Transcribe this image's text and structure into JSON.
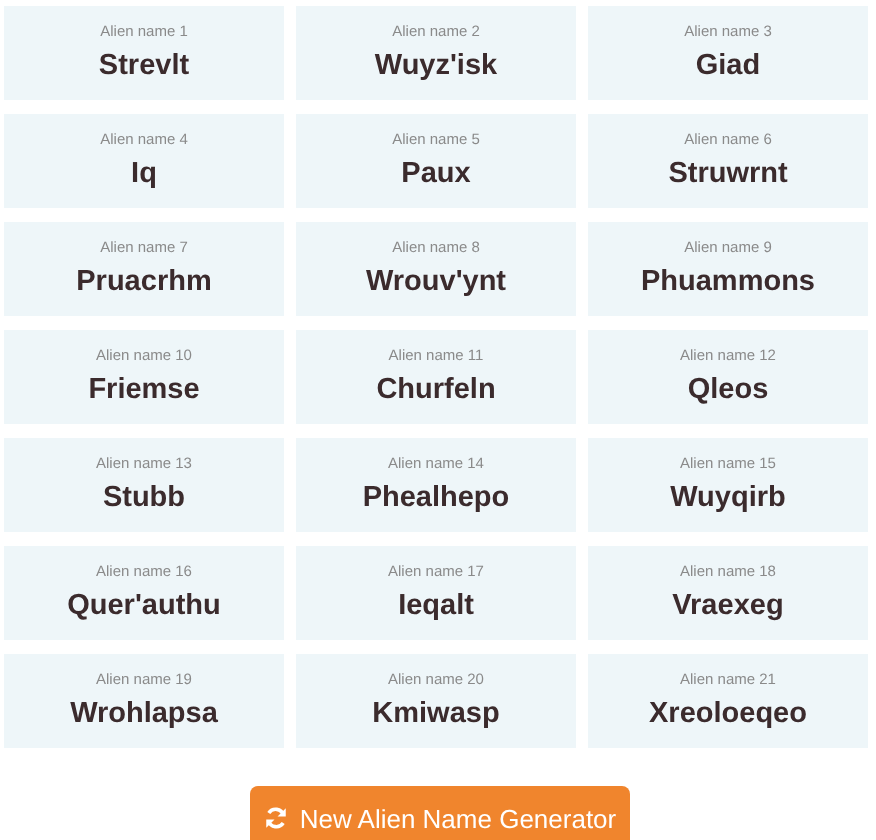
{
  "names": [
    {
      "label": "Alien name 1",
      "name": "Strevlt"
    },
    {
      "label": "Alien name 2",
      "name": "Wuyz'isk"
    },
    {
      "label": "Alien name 3",
      "name": "Giad"
    },
    {
      "label": "Alien name 4",
      "name": "Iq"
    },
    {
      "label": "Alien name 5",
      "name": "Paux"
    },
    {
      "label": "Alien name 6",
      "name": "Struwrnt"
    },
    {
      "label": "Alien name 7",
      "name": "Pruacrhm"
    },
    {
      "label": "Alien name 8",
      "name": "Wrouv'ynt"
    },
    {
      "label": "Alien name 9",
      "name": "Phuammons"
    },
    {
      "label": "Alien name 10",
      "name": "Friemse"
    },
    {
      "label": "Alien name 11",
      "name": "Churfeln"
    },
    {
      "label": "Alien name 12",
      "name": "Qleos"
    },
    {
      "label": "Alien name 13",
      "name": "Stubb"
    },
    {
      "label": "Alien name 14",
      "name": "Phealhepo"
    },
    {
      "label": "Alien name 15",
      "name": "Wuyqirb"
    },
    {
      "label": "Alien name 16",
      "name": "Quer'authu"
    },
    {
      "label": "Alien name 17",
      "name": "Ieqalt"
    },
    {
      "label": "Alien name 18",
      "name": "Vraexeg"
    },
    {
      "label": "Alien name 19",
      "name": "Wrohlapsa"
    },
    {
      "label": "Alien name 20",
      "name": "Kmiwasp"
    },
    {
      "label": "Alien name 21",
      "name": "Xreoloeqeo"
    }
  ],
  "button": {
    "label": "New Alien Name Generator"
  }
}
